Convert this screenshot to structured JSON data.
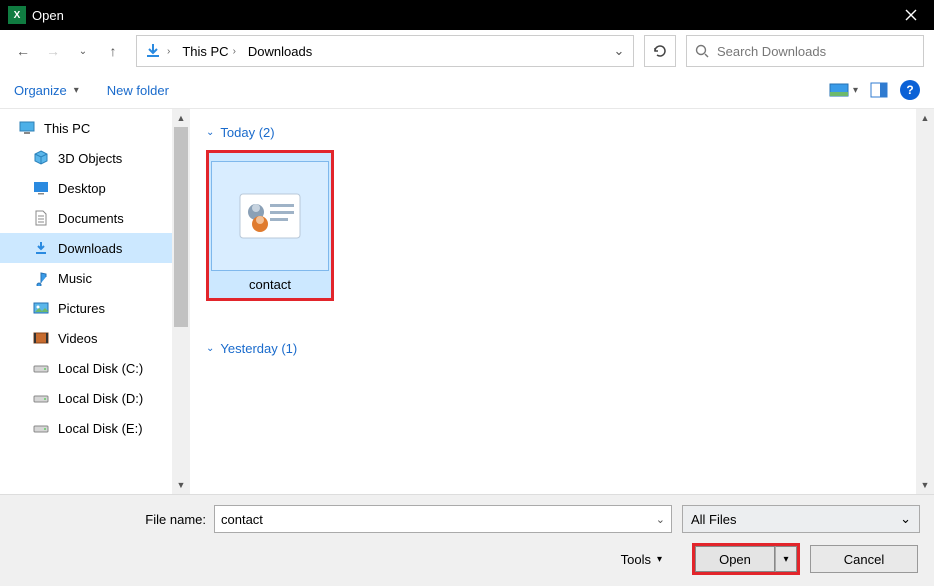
{
  "titlebar": {
    "title": "Open"
  },
  "breadcrumb": {
    "loc1": "This PC",
    "loc2": "Downloads"
  },
  "search": {
    "placeholder": "Search Downloads"
  },
  "toolbar": {
    "organize": "Organize",
    "newfolder": "New folder"
  },
  "sidebar": {
    "items": [
      {
        "label": "This PC"
      },
      {
        "label": "3D Objects"
      },
      {
        "label": "Desktop"
      },
      {
        "label": "Documents"
      },
      {
        "label": "Downloads"
      },
      {
        "label": "Music"
      },
      {
        "label": "Pictures"
      },
      {
        "label": "Videos"
      },
      {
        "label": "Local Disk (C:)"
      },
      {
        "label": "Local Disk (D:)"
      },
      {
        "label": "Local Disk (E:)"
      }
    ]
  },
  "content": {
    "group1": {
      "label": "Today (2)"
    },
    "tile1": {
      "label": "contact"
    },
    "group2": {
      "label": "Yesterday (1)"
    }
  },
  "bottom": {
    "filename_label": "File name:",
    "filename_value": "contact",
    "filter_label": "All Files",
    "tools": "Tools",
    "open": "Open",
    "cancel": "Cancel"
  }
}
